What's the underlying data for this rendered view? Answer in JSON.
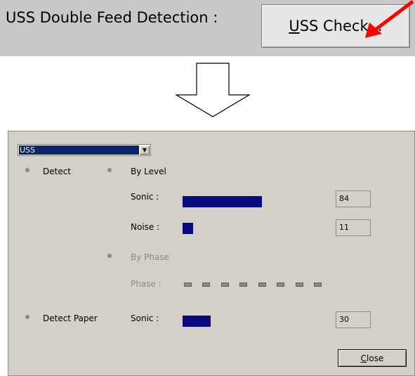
{
  "top": {
    "label": "USS Double Feed Detection :",
    "button_accel": "U",
    "button_rest": "SS Check..."
  },
  "dialog": {
    "combo_value": "USS",
    "detect_label": "Detect",
    "by_level_label": "By Level",
    "sonic_label": "Sonic :",
    "sonic_value": "84",
    "sonic_level_pct": 84,
    "noise_label": "Noise :",
    "noise_value": "11",
    "noise_level_pct": 11,
    "by_phase_label": "By Phase",
    "phase_label": "Phase :",
    "detect_paper_label": "Detect Paper",
    "paper_sonic_label": "Sonic :",
    "paper_sonic_value": "30",
    "paper_sonic_level_pct": 30,
    "close_accel": "C",
    "close_rest": "lose"
  },
  "icons": {
    "pointer": "red-arrow-icon",
    "transition": "down-arrow-icon",
    "dropdown": "chevron-down-icon"
  },
  "colors": {
    "bar": "#0a0a80",
    "selection": "#0a246a",
    "arrow": "#ff0000"
  }
}
